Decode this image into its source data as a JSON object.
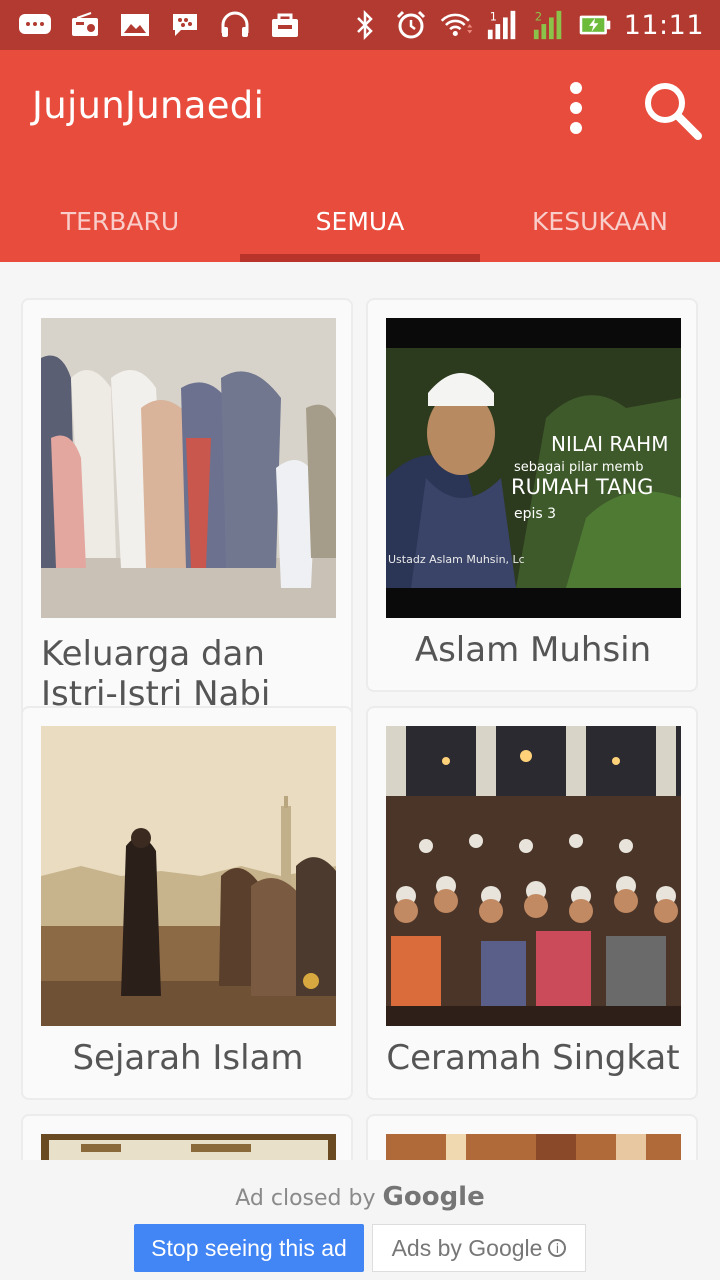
{
  "status_bar": {
    "time": "11:11",
    "icons": [
      "message-icon",
      "radio-icon",
      "gallery-icon",
      "bbm-icon",
      "headphones-icon",
      "bag-icon",
      "bluetooth-icon",
      "alarm-icon",
      "wifi-icon",
      "signal-1-icon",
      "signal-2-icon",
      "battery-charging-icon"
    ]
  },
  "app_bar": {
    "title": "JujunJunaedi",
    "menu_icon": "more-vert-icon",
    "search_icon": "search-icon"
  },
  "tabs": [
    {
      "label": "TERBARU",
      "active": false
    },
    {
      "label": "SEMUA",
      "active": true
    },
    {
      "label": "KESUKAAN",
      "active": false
    }
  ],
  "cards": [
    {
      "title": "Keluarga dan Istri-Istri Nabi"
    },
    {
      "title": "Aslam Muhsin",
      "thumb_caption": {
        "line1": "NILAI RAHM",
        "line2": "sebagai pilar memb",
        "line3": "RUMAH TANG",
        "line4": "epis 3",
        "credit": "Ustadz Aslam Muhsin, Lc"
      }
    },
    {
      "title": "Sejarah Islam"
    },
    {
      "title": "Ceramah Singkat"
    }
  ],
  "ad": {
    "closed_text": "Ad closed by",
    "brand": "Google",
    "stop_label": "Stop seeing this ad",
    "ads_by_label": "Ads by Google",
    "info_icon": "info-icon"
  },
  "colors": {
    "primary": "#e84c3d",
    "status_bar": "#b23a30",
    "tab_indicator": "#b8342a",
    "ad_button": "#4285f4"
  }
}
